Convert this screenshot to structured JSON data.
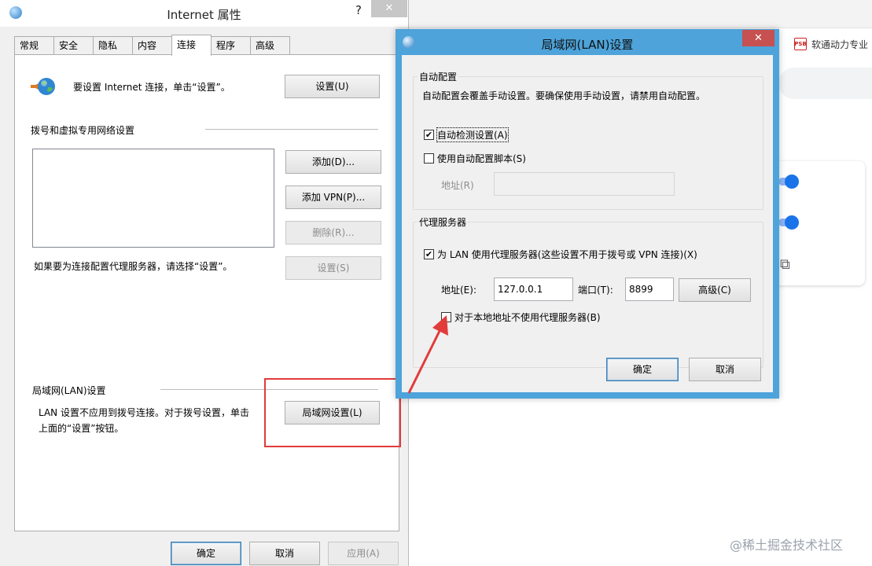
{
  "inet": {
    "title": "Internet 属性",
    "help": "?",
    "close": "✕",
    "tabs": [
      "常规",
      "安全",
      "隐私",
      "内容",
      "连接",
      "程序",
      "高级"
    ],
    "setup_text": "要设置 Internet 连接，单击“设置”。",
    "setup_button": "设置(U)",
    "dialup_section": "拨号和虚拟专用网络设置",
    "add_button": "添加(D)...",
    "add_vpn_button": "添加 VPN(P)...",
    "remove_button": "删除(R)...",
    "proxy_hint": "如果要为连接配置代理服务器，请选择“设置”。",
    "settings_button": "设置(S)",
    "lan_section": "局域网(LAN)设置",
    "lan_text_1": "LAN 设置不应用到拨号连接。对于拨号设置，单击",
    "lan_text_2": "上面的“设置”按钮。",
    "lan_button": "局域网设置(L)",
    "ok": "确定",
    "cancel": "取消",
    "apply": "应用(A)"
  },
  "lan": {
    "title": "局域网(LAN)设置",
    "close": "✕",
    "auto_group": "自动配置",
    "auto_desc": "自动配置会覆盖手动设置。要确保使用手动设置，请禁用自动配置。",
    "auto_detect": "自动检测设置(A)",
    "auto_detect_checked": true,
    "use_script": "使用自动配置脚本(S)",
    "use_script_checked": false,
    "script_address_label": "地址(R)",
    "script_address_value": "",
    "proxy_group": "代理服务器",
    "use_proxy": "为 LAN 使用代理服务器(这些设置不用于拨号或 VPN 连接)(X)",
    "use_proxy_checked": true,
    "address_label": "地址(E):",
    "address_value": "127.0.0.1",
    "port_label": "端口(T):",
    "port_value": "8899",
    "advanced_button": "高级(C)",
    "bypass_local": "对于本地地址不使用代理服务器(B)",
    "bypass_local_checked": false,
    "ok": "确定",
    "cancel": "取消"
  },
  "browser": {
    "bookmark_label": "软通动力专业",
    "bookmark_icon": "PSB"
  },
  "watermark": "@稀土掘金技术社区",
  "colors": {
    "annotation_red": "#e23b3b",
    "lan_frame": "#4da3da",
    "toggle_blue": "#1a73e8"
  }
}
